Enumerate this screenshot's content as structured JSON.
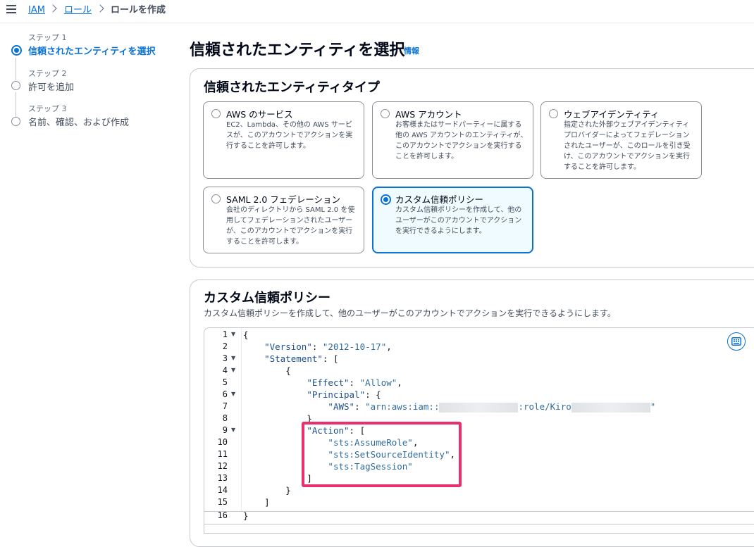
{
  "breadcrumb": {
    "items": [
      "IAM",
      "ロール",
      "ロールを作成"
    ]
  },
  "steps": [
    {
      "label": "ステップ 1",
      "title": "信頼されたエンティティを選択"
    },
    {
      "label": "ステップ 2",
      "title": "許可を追加"
    },
    {
      "label": "ステップ 3",
      "title": "名前、確認、および作成"
    }
  ],
  "page": {
    "title": "信頼されたエンティティを選択",
    "info": "情報"
  },
  "entity_type": {
    "title": "信頼されたエンティティタイプ",
    "options": [
      {
        "label": "AWS のサービス",
        "description": "EC2、Lambda、その他の AWS サービスが、このアカウントでアクションを実行することを許可します。"
      },
      {
        "label": "AWS アカウント",
        "description": "お客様またはサードパーティーに属する他の AWS アカウントのエンティティが、このアカウントでアクションを実行することを許可します。"
      },
      {
        "label": "ウェブアイデンティティ",
        "description": "指定された外部ウェブアイデンティティプロバイダーによってフェデレーションされたユーザーが、このロールを引き受け、このアカウントでアクションを実行することを許可します。"
      },
      {
        "label": "SAML 2.0 フェデレーション",
        "description": "会社のディレクトリから SAML 2.0 を使用してフェデレーションされたユーザーが、このアカウントでアクションを実行することを許可します。"
      },
      {
        "label": "カスタム信頼ポリシー",
        "description": "カスタム信頼ポリシーを作成して、他のユーザーがこのアカウントでアクションを実行できるようにします。"
      }
    ],
    "selected": "カスタム信頼ポリシー"
  },
  "custom_policy": {
    "title": "カスタム信頼ポリシー",
    "description": "カスタム信頼ポリシーを作成して、他のユーザーがこのアカウントでアクションを実行できるようにします。",
    "line_numbers": [
      "1",
      "2",
      "3",
      "4",
      "5",
      "6",
      "7",
      "8",
      "9",
      "10",
      "11",
      "12",
      "13",
      "14",
      "15",
      "16"
    ],
    "code": {
      "l1": "{",
      "l2_key": "\"Version\"",
      "l2_val": "\"2012-10-17\"",
      "l3_key": "\"Statement\"",
      "l4": "{",
      "l5_key": "\"Effect\"",
      "l5_val": "\"Allow\"",
      "l6_key": "\"Principal\"",
      "l7_key": "\"AWS\"",
      "l7_val_a": "\"arn:aws:iam::",
      "l7_val_b": ":role/Kiro",
      "l7_val_c": "\"",
      "l8": "}",
      "l9_key": "\"Action\"",
      "l10": "\"sts:AssumeRole\"",
      "l11": "\"sts:SetSourceIdentity\"",
      "l12": "\"sts:TagSession\"",
      "l13": "]",
      "l14": "}",
      "l15": "]",
      "l16": "}"
    }
  },
  "colors": {
    "accent": "#0972d3",
    "highlight": "#e8316c",
    "selected_bg": "#f0fbff"
  }
}
